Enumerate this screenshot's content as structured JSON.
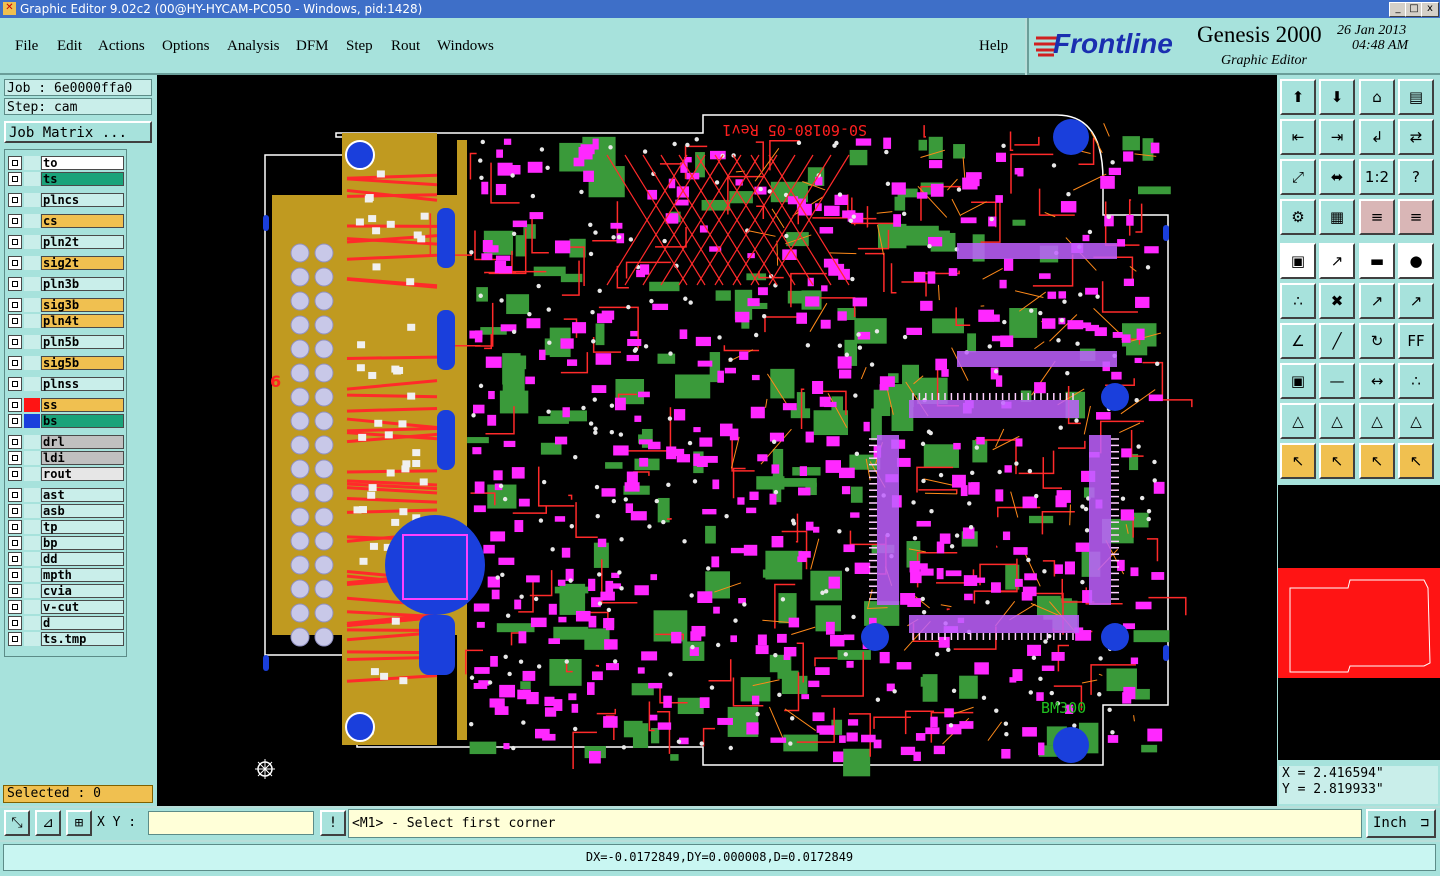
{
  "window": {
    "title": "Graphic Editor 9.02c2 (00@HY-HYCAM-PC050 - Windows, pid:1428)",
    "min_label": "_",
    "max_label": "□",
    "close_label": "x"
  },
  "menu": {
    "items": [
      "File",
      "Edit",
      "Actions",
      "Options",
      "Analysis",
      "DFM",
      "Step",
      "Rout",
      "Windows"
    ],
    "help": "Help"
  },
  "brand": {
    "logo": "Frontline",
    "product": "Genesis 2000",
    "date": "26 Jan 2013",
    "time": "04:48 AM",
    "subtitle": "Graphic Editor"
  },
  "job": {
    "job_label": "Job : 6e0000ffa0",
    "step_label": "Step: cam",
    "matrix_button": "Job Matrix ..."
  },
  "layers": [
    {
      "name": "to",
      "color": "#ffffff",
      "edit": ""
    },
    {
      "name": "ts",
      "color": "#1aa37a",
      "edit": ""
    },
    {
      "name": "plncs",
      "color": "#c9eeea",
      "edit": ""
    },
    {
      "name": "cs",
      "color": "#f0c050",
      "edit": "✎"
    },
    {
      "name": "pln2t",
      "color": "#c9eeea",
      "edit": ""
    },
    {
      "name": "sig2t",
      "color": "#f0c050",
      "edit": "✎"
    },
    {
      "name": "pln3b",
      "color": "#c9eeea",
      "edit": ""
    },
    {
      "name": "sig3b",
      "color": "#f0c050",
      "edit": "✎"
    },
    {
      "name": "pln4t",
      "color": "#f0c050",
      "edit": ""
    },
    {
      "name": "pln5b",
      "color": "#c9eeea",
      "edit": ""
    },
    {
      "name": "sig5b",
      "color": "#f0c050",
      "edit": "✎"
    },
    {
      "name": "plnss",
      "color": "#c9eeea",
      "edit": ""
    },
    {
      "name": "ss",
      "color": "#f0c050",
      "edit": "✎"
    },
    {
      "name": "bs",
      "color": "#1aa37a",
      "edit": ""
    },
    {
      "name": "drl",
      "color": "#c0c0c0",
      "edit": ""
    },
    {
      "name": "ldi",
      "color": "#c0c0c0",
      "edit": ""
    },
    {
      "name": "rout",
      "color": "#e6e6e6",
      "edit": ""
    },
    {
      "name": "ast",
      "color": "#c9eeea",
      "edit": ""
    },
    {
      "name": "asb",
      "color": "#c9eeea",
      "edit": ""
    },
    {
      "name": "tp",
      "color": "#c9eeea",
      "edit": ""
    },
    {
      "name": "bp",
      "color": "#c9eeea",
      "edit": ""
    },
    {
      "name": "dd",
      "color": "#c9eeea",
      "edit": ""
    },
    {
      "name": "mpth",
      "color": "#c9eeea",
      "edit": ""
    },
    {
      "name": "cvia",
      "color": "#c9eeea",
      "edit": ""
    },
    {
      "name": "v-cut",
      "color": "#c9eeea",
      "edit": ""
    },
    {
      "name": "d",
      "color": "#c9eeea",
      "edit": ""
    },
    {
      "name": "ts.tmp",
      "color": "#c9eeea",
      "edit": ""
    }
  ],
  "selected": "Selected : 0",
  "board": {
    "part_text": "S0-60180-05 Rev1",
    "bm_text": "BM300",
    "side_mark": "6"
  },
  "toolbar_icons": [
    "zoom-home-icon",
    "zoom-fit-icon",
    "home-icon",
    "page-icon",
    "pan-left-icon",
    "pan-right-icon",
    "step-icon",
    "snap-icon",
    "fit-profile-icon",
    "center-icon",
    "ratio-icon",
    "help-icon",
    "settings-icon",
    "grid-icon",
    "layer-a-icon",
    "layer-b-icon",
    "camera-icon",
    "cursor-box-icon",
    "ruler-icon",
    "dot-icon",
    "connect-icon",
    "cross-icon",
    "measure-icon",
    "measure2-icon",
    "angle-icon",
    "line-icon",
    "arc-icon",
    "ff-icon",
    "select-icon",
    "split-icon",
    "move-icon",
    "net-icon",
    "tri-icon",
    "tri2-icon",
    "tri3-icon",
    "tri4-icon",
    "pointer-icon",
    "pointer-box-icon",
    "pointer2-icon",
    "route-icon"
  ],
  "toolbar_glyphs": [
    "⬆",
    "⬇",
    "⌂",
    "▤",
    "⇤",
    "⇥",
    "↲",
    "⇄",
    "⤢",
    "⬌",
    "1:2",
    "?",
    "⚙",
    "▦",
    "≡",
    "≡",
    "▣",
    "↗",
    "▬",
    "●",
    "∴",
    "✖",
    "↗",
    "↗",
    "∠",
    "╱",
    "↻",
    "FF",
    "▣",
    "—",
    "↔",
    "∴",
    "△",
    "△",
    "△",
    "△",
    "↖",
    "↖",
    "↖",
    "↖"
  ],
  "coords": {
    "x": "X = 2.416594\"",
    "y": "Y = 2.819933\""
  },
  "bottom": {
    "xy_label": "X Y :",
    "xy_value": "",
    "message": "<M1> - Select first corner",
    "units": "Inch",
    "status": "DX=-0.0172849,DY=0.000008,D=0.0172849"
  }
}
